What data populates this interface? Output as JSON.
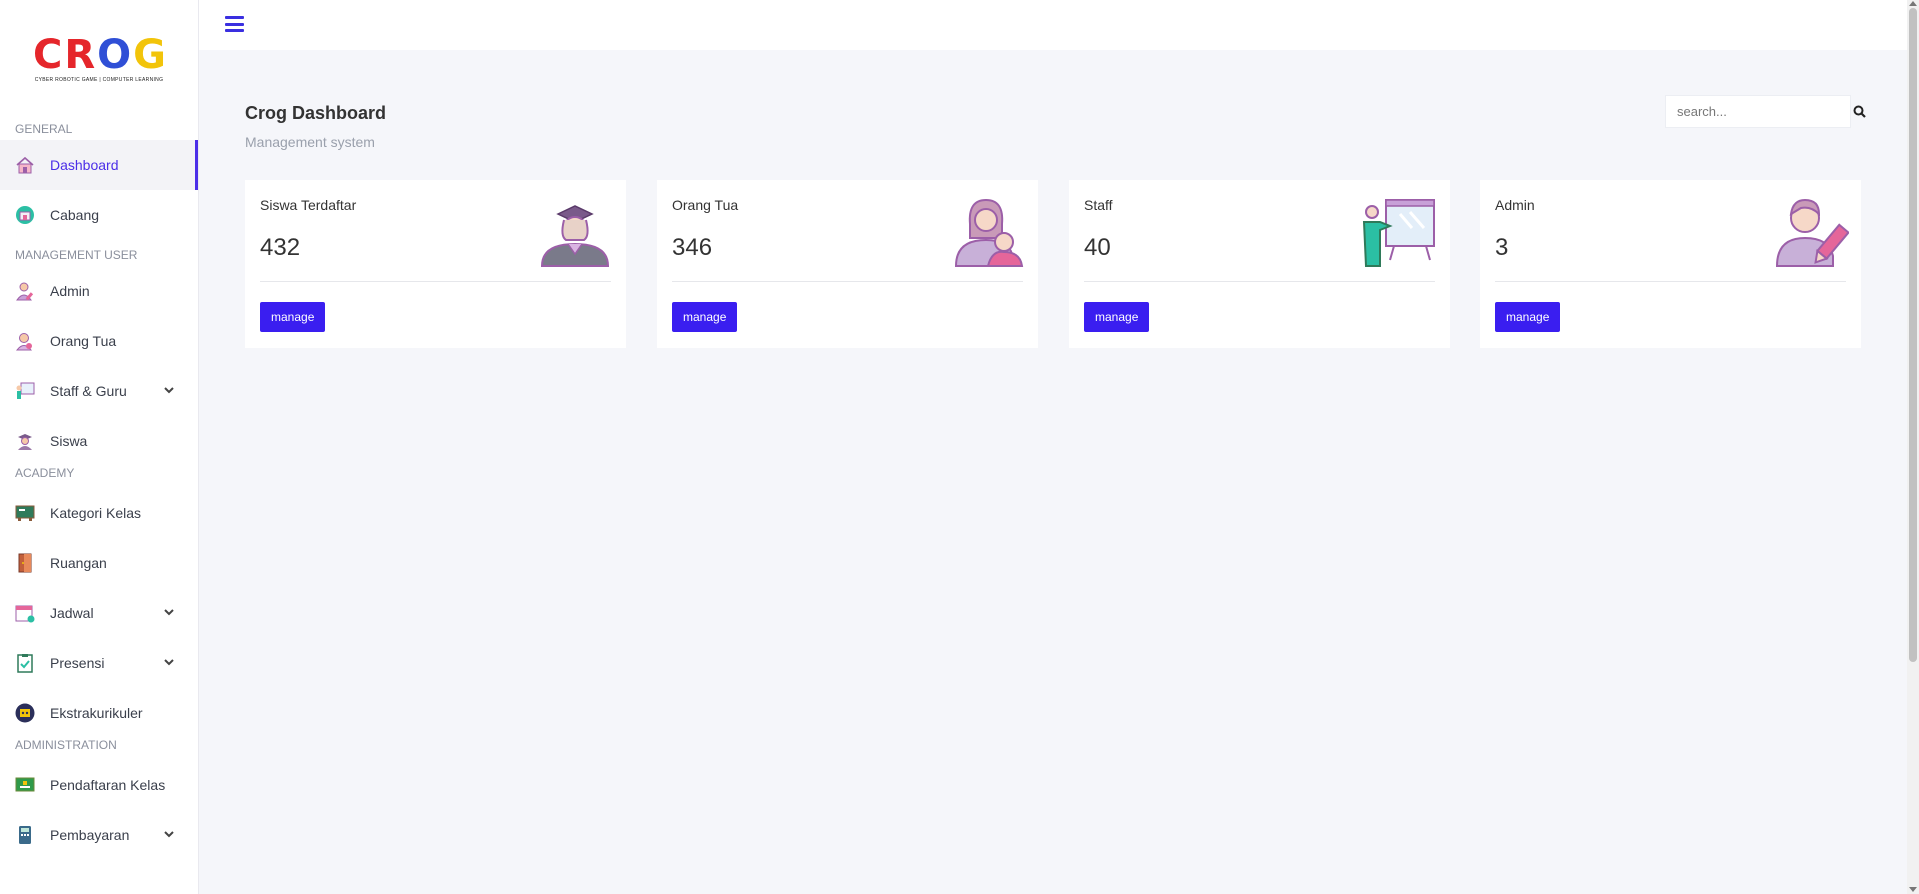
{
  "logo": {
    "letters": [
      {
        "char": "C",
        "color": "#e5262b"
      },
      {
        "char": "R",
        "color": "#e5262b"
      },
      {
        "char": "O",
        "color": "#2f4fd6"
      },
      {
        "char": "G",
        "color": "#f2c40a"
      }
    ],
    "tagline": "CYBER ROBOTIC GAME | COMPUTER LEARNING"
  },
  "sidebar": {
    "sections": [
      {
        "title": "GENERAL",
        "items": [
          {
            "label": "Dashboard",
            "icon": "home-icon",
            "active": true
          },
          {
            "label": "Cabang",
            "icon": "building-icon"
          }
        ]
      },
      {
        "title": "MANAGEMENT USER",
        "items": [
          {
            "label": "Admin",
            "icon": "admin-user-icon"
          },
          {
            "label": "Orang Tua",
            "icon": "parent-icon"
          },
          {
            "label": "Staff & Guru",
            "icon": "teacher-icon",
            "expandable": true
          },
          {
            "label": "Siswa",
            "icon": "student-icon"
          }
        ]
      },
      {
        "title": "ACADEMY",
        "items": [
          {
            "label": "Kategori Kelas",
            "icon": "class-category-icon"
          },
          {
            "label": "Ruangan",
            "icon": "door-icon"
          },
          {
            "label": "Jadwal",
            "icon": "calendar-icon",
            "expandable": true
          },
          {
            "label": "Presensi",
            "icon": "clipboard-icon",
            "expandable": true
          },
          {
            "label": "Ekstrakurikuler",
            "icon": "robot-icon"
          }
        ]
      },
      {
        "title": "ADMINISTRATION",
        "items": [
          {
            "label": "Pendaftaran Kelas",
            "icon": "registration-icon"
          },
          {
            "label": "Pembayaran",
            "icon": "payment-icon",
            "expandable": true
          }
        ]
      }
    ]
  },
  "header": {
    "title": "Crog Dashboard",
    "subtitle": "Management system"
  },
  "search": {
    "placeholder": "search..."
  },
  "cards": [
    {
      "title": "Siswa Terdaftar",
      "value": "432",
      "button": "manage",
      "icon": "graduate-student-icon"
    },
    {
      "title": "Orang Tua",
      "value": "346",
      "button": "manage",
      "icon": "mother-child-icon"
    },
    {
      "title": "Staff",
      "value": "40",
      "button": "manage",
      "icon": "presenter-board-icon"
    },
    {
      "title": "Admin",
      "value": "3",
      "button": "manage",
      "icon": "admin-pencil-icon"
    }
  ],
  "colors": {
    "accent": "#4b2ee8",
    "button": "#3a1ef0",
    "background": "#f5f6fa"
  }
}
